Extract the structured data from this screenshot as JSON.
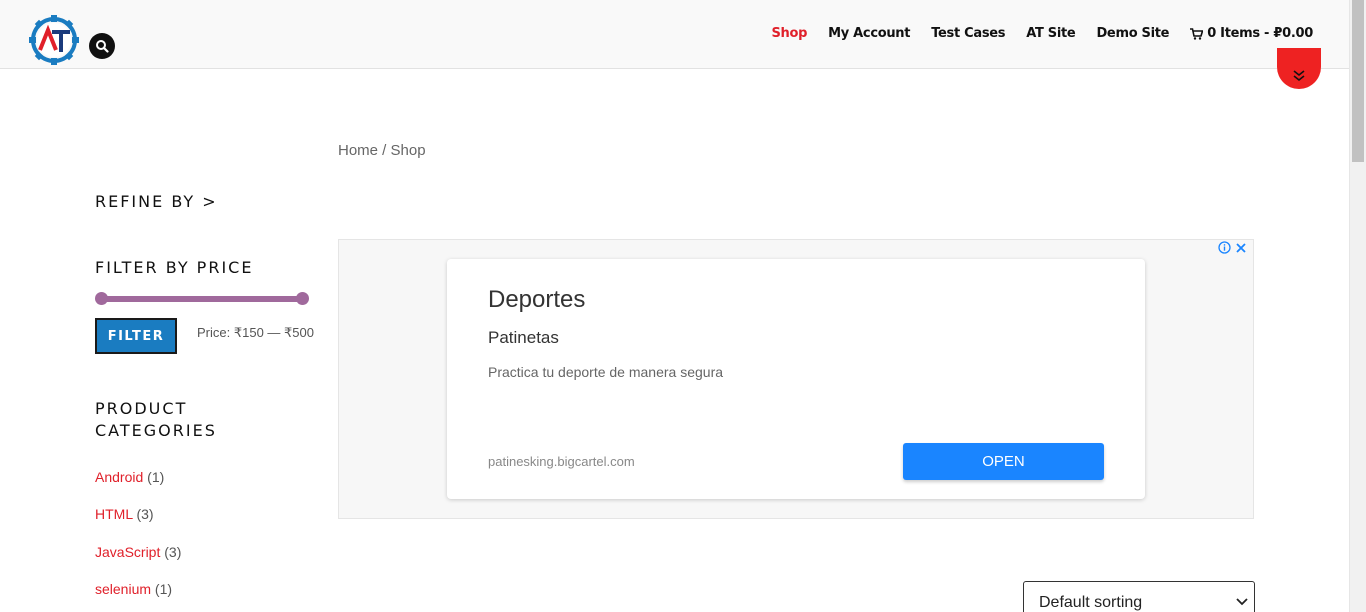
{
  "header": {
    "logo_letters": "AT",
    "nav": [
      {
        "label": "Shop",
        "active": true
      },
      {
        "label": "My Account",
        "active": false
      },
      {
        "label": "Test Cases",
        "active": false
      },
      {
        "label": "AT Site",
        "active": false
      },
      {
        "label": "Demo Site",
        "active": false
      }
    ],
    "cart_label": "0 Items - ₽0.00",
    "icons": [
      "search-icon",
      "cart-icon",
      "chevron-double-down-icon"
    ]
  },
  "breadcrumb": {
    "home": "Home",
    "separator": " / ",
    "current": "Shop"
  },
  "sidebar": {
    "refine_title": "REFINE BY >",
    "filter_price_title": "FILTER BY PRICE",
    "filter_button": "FILTER",
    "price_label": "Price: ₹150 — ₹500",
    "price_range": {
      "min": 150,
      "max": 500,
      "slider_min_pos": 0.0,
      "slider_max_pos": 1.0
    },
    "categories_title_line1": "PRODUCT",
    "categories_title_line2": "CATEGORIES",
    "categories": [
      {
        "name": "Android",
        "count": "(1)"
      },
      {
        "name": "HTML",
        "count": "(3)"
      },
      {
        "name": "JavaScript",
        "count": "(3)"
      },
      {
        "name": "selenium",
        "count": "(1)"
      }
    ]
  },
  "ad": {
    "title": "Deportes",
    "subtitle": "Patinetas",
    "description": "Practica tu deporte de manera segura",
    "url": "patinesking.bigcartel.com",
    "button": "OPEN"
  },
  "sorting": {
    "selected": "Default sorting"
  },
  "colors": {
    "accent_red": "#e0202a",
    "filter_blue": "#1a7cc1",
    "slider_purple": "#a0699c",
    "ad_button_blue": "#1a85ff"
  }
}
